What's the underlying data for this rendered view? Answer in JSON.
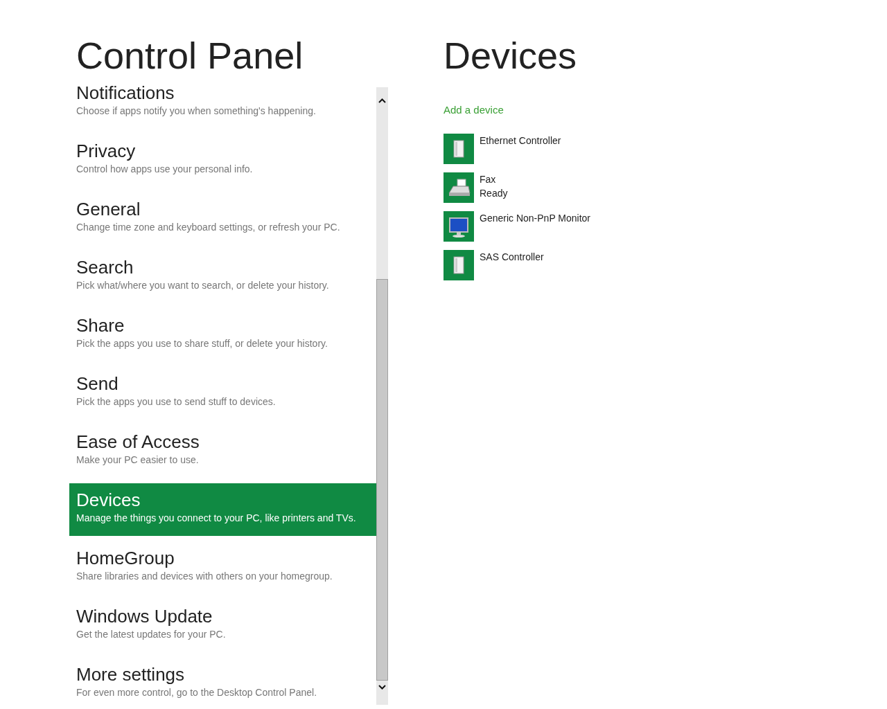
{
  "left_title": "Control Panel",
  "settings": [
    {
      "title": "Notifications",
      "description": "Choose if apps notify you when something's happening.",
      "selected": false
    },
    {
      "title": "Privacy",
      "description": "Control how apps use your personal info.",
      "selected": false
    },
    {
      "title": "General",
      "description": "Change time zone and keyboard settings, or refresh your PC.",
      "selected": false
    },
    {
      "title": "Search",
      "description": "Pick what/where you want to search, or delete your history.",
      "selected": false
    },
    {
      "title": "Share",
      "description": "Pick the apps you use to share stuff, or delete your history.",
      "selected": false
    },
    {
      "title": "Send",
      "description": "Pick the apps you use to send stuff to devices.",
      "selected": false
    },
    {
      "title": "Ease of Access",
      "description": "Make your PC easier to use.",
      "selected": false
    },
    {
      "title": "Devices",
      "description": "Manage the things you connect to your PC, like printers and TVs.",
      "selected": true
    },
    {
      "title": "HomeGroup",
      "description": "Share libraries and devices with others on your homegroup.",
      "selected": false
    },
    {
      "title": "Windows Update",
      "description": "Get the latest updates for your PC.",
      "selected": false
    },
    {
      "title": "More settings",
      "description": "For even more control, go to the Desktop Control Panel.",
      "selected": false
    }
  ],
  "right_title": "Devices",
  "add_link": "Add a device",
  "devices": [
    {
      "kind": "tower",
      "name": "Ethernet Controller"
    },
    {
      "kind": "fax",
      "name": "Fax",
      "status": "Ready"
    },
    {
      "kind": "monitor",
      "name": "Generic Non-PnP Monitor"
    },
    {
      "kind": "tower",
      "name": "SAS Controller"
    }
  ]
}
